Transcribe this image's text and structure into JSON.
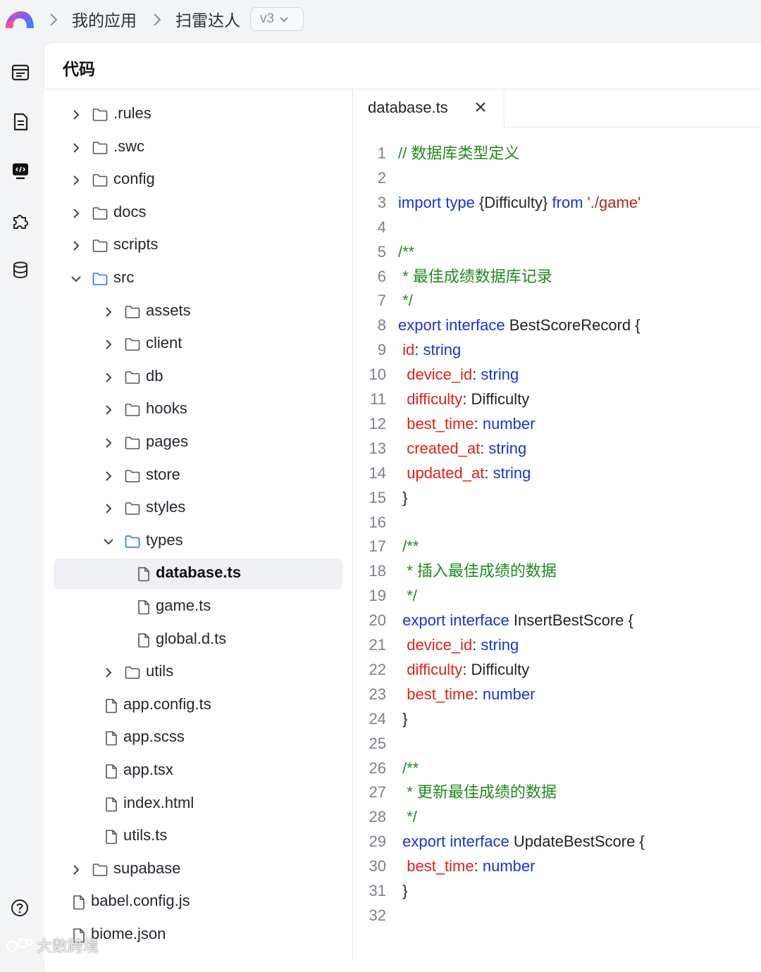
{
  "breadcrumb": {
    "items": [
      "我的应用",
      "扫雷达人"
    ],
    "version": "v3"
  },
  "panel": {
    "title": "代码"
  },
  "rail": {
    "icons": [
      "list-icon",
      "document-icon",
      "code-monitor-icon",
      "puzzle-icon",
      "database-icon"
    ],
    "help": "help-icon"
  },
  "tree": {
    "rows": [
      {
        "name": ".rules",
        "type": "folder",
        "depth": 0,
        "expanded": false
      },
      {
        "name": ".swc",
        "type": "folder",
        "depth": 0,
        "expanded": false
      },
      {
        "name": "config",
        "type": "folder",
        "depth": 0,
        "expanded": false
      },
      {
        "name": "docs",
        "type": "folder",
        "depth": 0,
        "expanded": false
      },
      {
        "name": "scripts",
        "type": "folder",
        "depth": 0,
        "expanded": false
      },
      {
        "name": "src",
        "type": "folder",
        "depth": 0,
        "expanded": true
      },
      {
        "name": "assets",
        "type": "folder",
        "depth": 1,
        "expanded": false
      },
      {
        "name": "client",
        "type": "folder",
        "depth": 1,
        "expanded": false
      },
      {
        "name": "db",
        "type": "folder",
        "depth": 1,
        "expanded": false
      },
      {
        "name": "hooks",
        "type": "folder",
        "depth": 1,
        "expanded": false
      },
      {
        "name": "pages",
        "type": "folder",
        "depth": 1,
        "expanded": false
      },
      {
        "name": "store",
        "type": "folder",
        "depth": 1,
        "expanded": false
      },
      {
        "name": "styles",
        "type": "folder",
        "depth": 1,
        "expanded": false
      },
      {
        "name": "types",
        "type": "folder",
        "depth": 1,
        "expanded": true
      },
      {
        "name": "database.ts",
        "type": "file",
        "depth": 2,
        "selected": true
      },
      {
        "name": "game.ts",
        "type": "file",
        "depth": 2
      },
      {
        "name": "global.d.ts",
        "type": "file",
        "depth": 2
      },
      {
        "name": "utils",
        "type": "folder",
        "depth": 1,
        "expanded": false
      },
      {
        "name": "app.config.ts",
        "type": "file",
        "depth": 1
      },
      {
        "name": "app.scss",
        "type": "file",
        "depth": 1
      },
      {
        "name": "app.tsx",
        "type": "file",
        "depth": 1
      },
      {
        "name": "index.html",
        "type": "file",
        "depth": 1
      },
      {
        "name": "utils.ts",
        "type": "file",
        "depth": 1
      },
      {
        "name": "supabase",
        "type": "folder",
        "depth": 0,
        "expanded": false
      },
      {
        "name": "babel.config.js",
        "type": "file",
        "depth": 0
      },
      {
        "name": "biome.json",
        "type": "file",
        "depth": 0
      }
    ]
  },
  "editor": {
    "tab": "database.ts",
    "lines": [
      [
        [
          "c",
          "// 数据库类型定义"
        ]
      ],
      [],
      [
        [
          "k",
          "import type "
        ],
        [
          "t",
          "{Difficulty} "
        ],
        [
          "k",
          "from "
        ],
        [
          "s",
          "'./game'"
        ]
      ],
      [],
      [
        [
          "c",
          "/**"
        ]
      ],
      [
        [
          "c",
          " * 最佳成绩数据库记录"
        ]
      ],
      [
        [
          "c",
          " */"
        ]
      ],
      [
        [
          "k",
          "export interface "
        ],
        [
          "t",
          "BestScoreRecord {"
        ]
      ],
      [
        [
          "p",
          " id"
        ],
        [
          "t",
          ": "
        ],
        [
          "k",
          "string"
        ]
      ],
      [
        [
          "p",
          "  device_id"
        ],
        [
          "t",
          ": "
        ],
        [
          "k",
          "string"
        ]
      ],
      [
        [
          "p",
          "  difficulty"
        ],
        [
          "t",
          ": Difficulty"
        ]
      ],
      [
        [
          "p",
          "  best_time"
        ],
        [
          "t",
          ": "
        ],
        [
          "k",
          "number"
        ]
      ],
      [
        [
          "p",
          "  created_at"
        ],
        [
          "t",
          ": "
        ],
        [
          "k",
          "string"
        ]
      ],
      [
        [
          "p",
          "  updated_at"
        ],
        [
          "t",
          ": "
        ],
        [
          "k",
          "string"
        ]
      ],
      [
        [
          "t",
          " }"
        ]
      ],
      [],
      [
        [
          "c",
          " /**"
        ]
      ],
      [
        [
          "c",
          "  * 插入最佳成绩的数据"
        ]
      ],
      [
        [
          "c",
          "  */"
        ]
      ],
      [
        [
          "k",
          " export interface "
        ],
        [
          "t",
          "InsertBestScore {"
        ]
      ],
      [
        [
          "p",
          "  device_id"
        ],
        [
          "t",
          ": "
        ],
        [
          "k",
          "string"
        ]
      ],
      [
        [
          "p",
          "  difficulty"
        ],
        [
          "t",
          ": Difficulty"
        ]
      ],
      [
        [
          "p",
          "  best_time"
        ],
        [
          "t",
          ": "
        ],
        [
          "k",
          "number"
        ]
      ],
      [
        [
          "t",
          " }"
        ]
      ],
      [],
      [
        [
          "c",
          " /**"
        ]
      ],
      [
        [
          "c",
          "  * 更新最佳成绩的数据"
        ]
      ],
      [
        [
          "c",
          "  */"
        ]
      ],
      [
        [
          "k",
          " export interface "
        ],
        [
          "t",
          "UpdateBestScore {"
        ]
      ],
      [
        [
          "p",
          "  best_time"
        ],
        [
          "t",
          ": "
        ],
        [
          "k",
          "number"
        ]
      ],
      [
        [
          "t",
          " }"
        ]
      ],
      []
    ]
  },
  "colors": {
    "keyword": "#1a33d6",
    "string": "#b02a1f",
    "property": "#e0201b",
    "comment": "#1f8a1f",
    "folder_expanded": "#2f6bff"
  },
  "watermark": "大数跨境"
}
